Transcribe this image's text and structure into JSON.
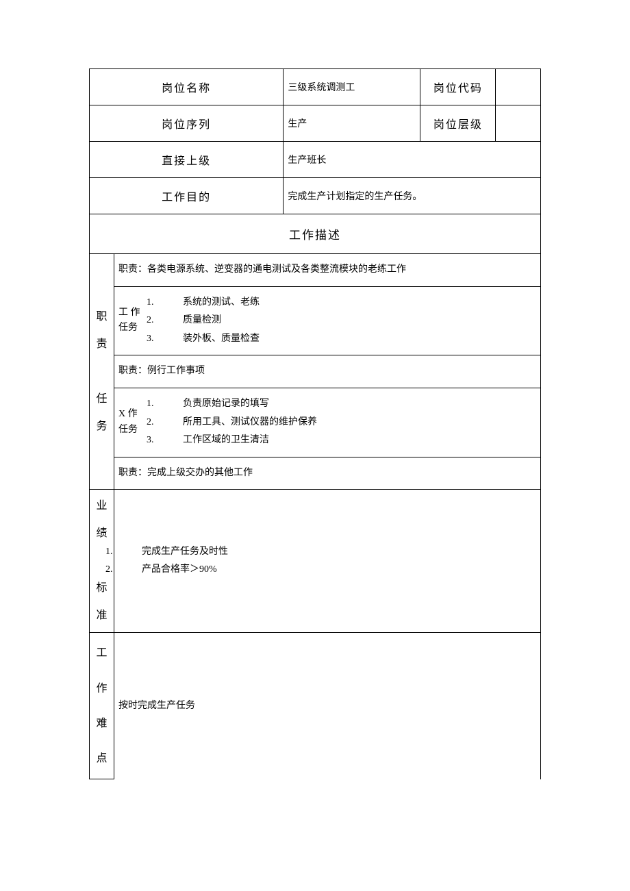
{
  "header": {
    "position_name_label": "岗位名称",
    "position_name_value": "三级系统调测工",
    "position_code_label": "岗位代码",
    "position_code_value": "",
    "position_series_label": "岗位序列",
    "position_series_value": "生产",
    "position_level_label": "岗位层级",
    "position_level_value": "",
    "supervisor_label": "直接上级",
    "supervisor_value": "生产班长",
    "purpose_label": "工作目的",
    "purpose_value": "完成生产计划指定的生产任务。"
  },
  "description_header": "工作描述",
  "duties": {
    "side_label_line1": "职责",
    "side_label_line2": "任务",
    "duty1_title": "职责：各类电源系统、逆变器的通电测试及各类整流模块的老练工作",
    "task_label1": "工 作任务",
    "duty1_items": [
      "系统的测试、老练",
      "质量检测",
      "装外板、质量检查"
    ],
    "duty2_title": "职责：例行工作事项",
    "task_label2": "X 作任务",
    "duty2_items": [
      "负责原始记录的填写",
      "所用工具、测试仪器的维护保养",
      "工作区域的卫生清洁"
    ],
    "duty3_title": "职责：完成上级交办的其他工作"
  },
  "performance": {
    "side_label_line1": "业绩",
    "side_label_line2": "标准",
    "items": [
      "完成生产任务及时性",
      "产品合格率＞90%"
    ]
  },
  "difficulty": {
    "side_label": "工作难点",
    "value": "按时完成生产任务"
  }
}
